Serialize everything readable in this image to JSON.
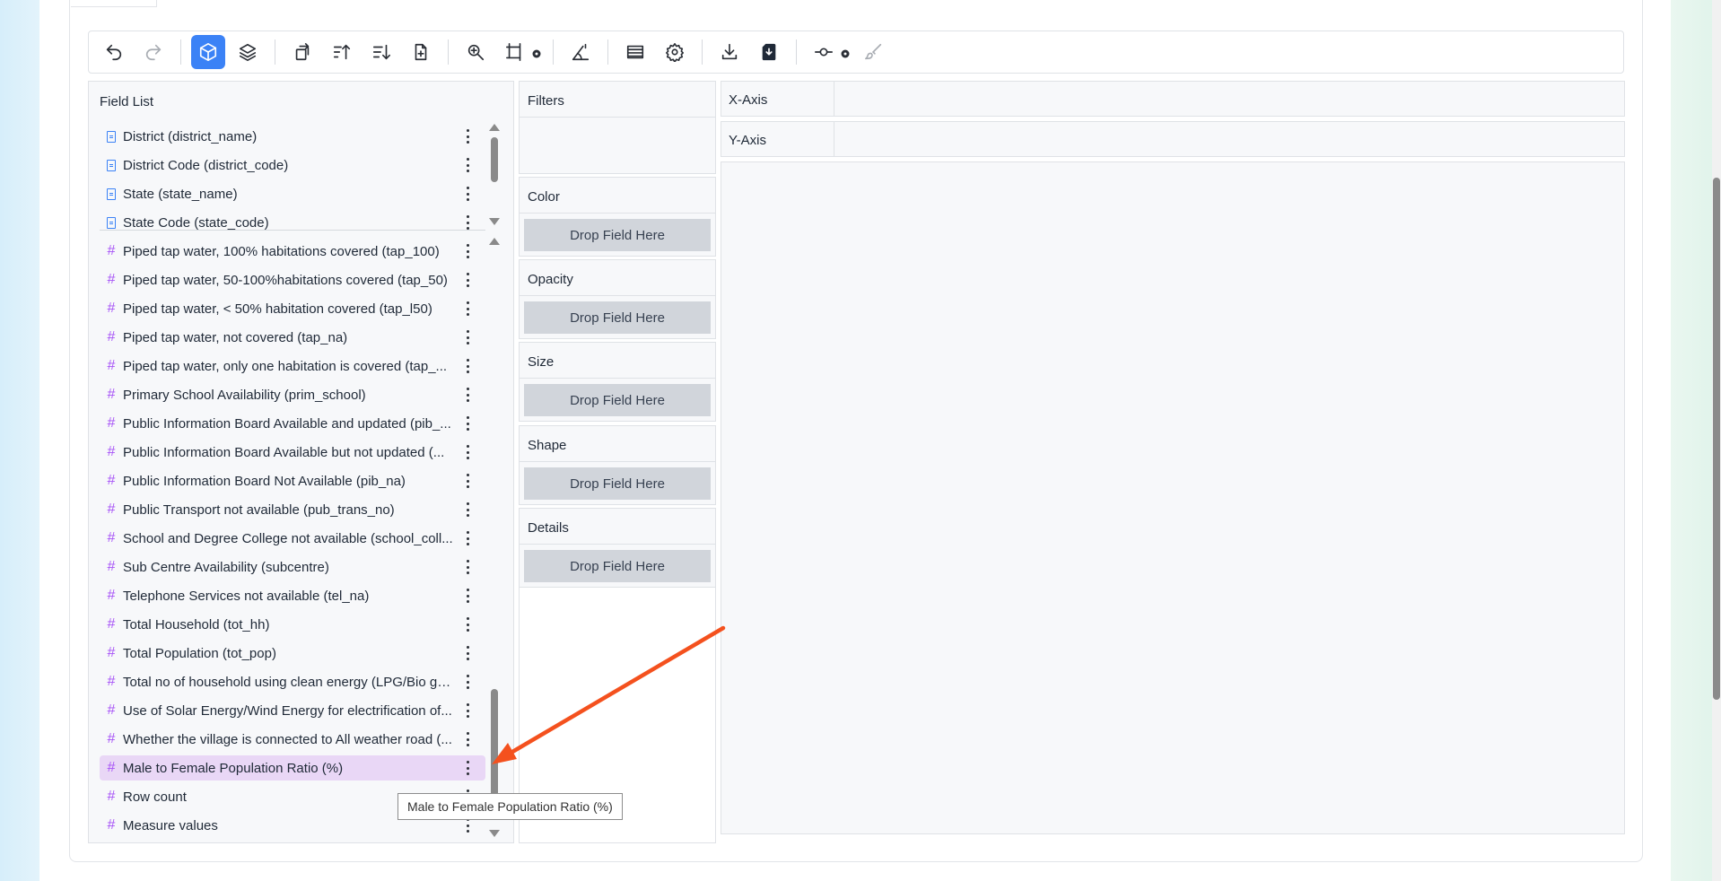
{
  "toolbar": {
    "buttons": [
      {
        "name": "undo-icon",
        "state": "normal"
      },
      {
        "name": "redo-icon",
        "state": "disabled"
      },
      {
        "name": "cube-icon",
        "state": "active"
      },
      {
        "name": "layers-icon",
        "state": "normal"
      },
      {
        "name": "transpose-icon",
        "state": "normal"
      },
      {
        "name": "sort-ascending-icon",
        "state": "normal"
      },
      {
        "name": "sort-descending-icon",
        "state": "normal"
      },
      {
        "name": "new-file-icon",
        "state": "normal"
      },
      {
        "name": "zoom-in-icon",
        "state": "normal"
      },
      {
        "name": "frame-size-icon",
        "state": "normal"
      },
      {
        "name": "axis-scale-icon",
        "state": "normal"
      },
      {
        "name": "table-icon",
        "state": "normal"
      },
      {
        "name": "settings-icon",
        "state": "normal"
      },
      {
        "name": "download-icon",
        "state": "normal"
      },
      {
        "name": "export-image-icon",
        "state": "normal"
      },
      {
        "name": "commit-node-icon",
        "state": "normal"
      },
      {
        "name": "paint-brush-icon",
        "state": "disabled"
      }
    ],
    "active_color": "#3b82f6"
  },
  "field_list": {
    "title": "Field List",
    "dimensions": [
      "District (district_name)",
      "District Code (district_code)",
      "State (state_name)",
      "State Code (state_code)"
    ],
    "measures": [
      "Piped tap water, 100% habitations covered (tap_100)",
      "Piped tap water, 50-100%habitations covered (tap_50)",
      "Piped tap water, < 50% habitation covered (tap_l50)",
      "Piped tap water, not covered (tap_na)",
      "Piped tap water, only one habitation is covered (tap_...",
      "Primary School Availability (prim_school)",
      "Public Information Board Available and updated (pib_...",
      "Public Information Board Available but not updated (...",
      "Public Information Board Not Available (pib_na)",
      "Public Transport not available (pub_trans_no)",
      "School and Degree College not available (school_coll...",
      "Sub Centre Availability (subcentre)",
      "Telephone Services not available (tel_na)",
      "Total Household (tot_hh)",
      "Total Population (tot_pop)",
      "Total no of household using clean energy (LPG/Bio ga...",
      "Use of Solar Energy/Wind Energy for electrification of...",
      "Whether the village is connected to All weather road (...",
      "Male to Female Population Ratio (%)",
      "Row count",
      "Measure values"
    ],
    "highlighted_measure": "Male to Female Population Ratio (%)",
    "dimension_icon_color": "#3b82f6",
    "measure_icon_color": "#a855f7",
    "highlight_color": "#e9d7f6"
  },
  "encodings": {
    "filters_label": "Filters",
    "channels": [
      {
        "label": "Color",
        "drop_text": "Drop Field Here"
      },
      {
        "label": "Opacity",
        "drop_text": "Drop Field Here"
      },
      {
        "label": "Size",
        "drop_text": "Drop Field Here"
      },
      {
        "label": "Shape",
        "drop_text": "Drop Field Here"
      },
      {
        "label": "Details",
        "drop_text": "Drop Field Here"
      }
    ]
  },
  "axes": {
    "x_label": "X-Axis",
    "y_label": "Y-Axis"
  },
  "tooltip": {
    "text": "Male to Female Population Ratio (%)"
  },
  "annotation": {
    "arrow_color": "#f4511e"
  }
}
